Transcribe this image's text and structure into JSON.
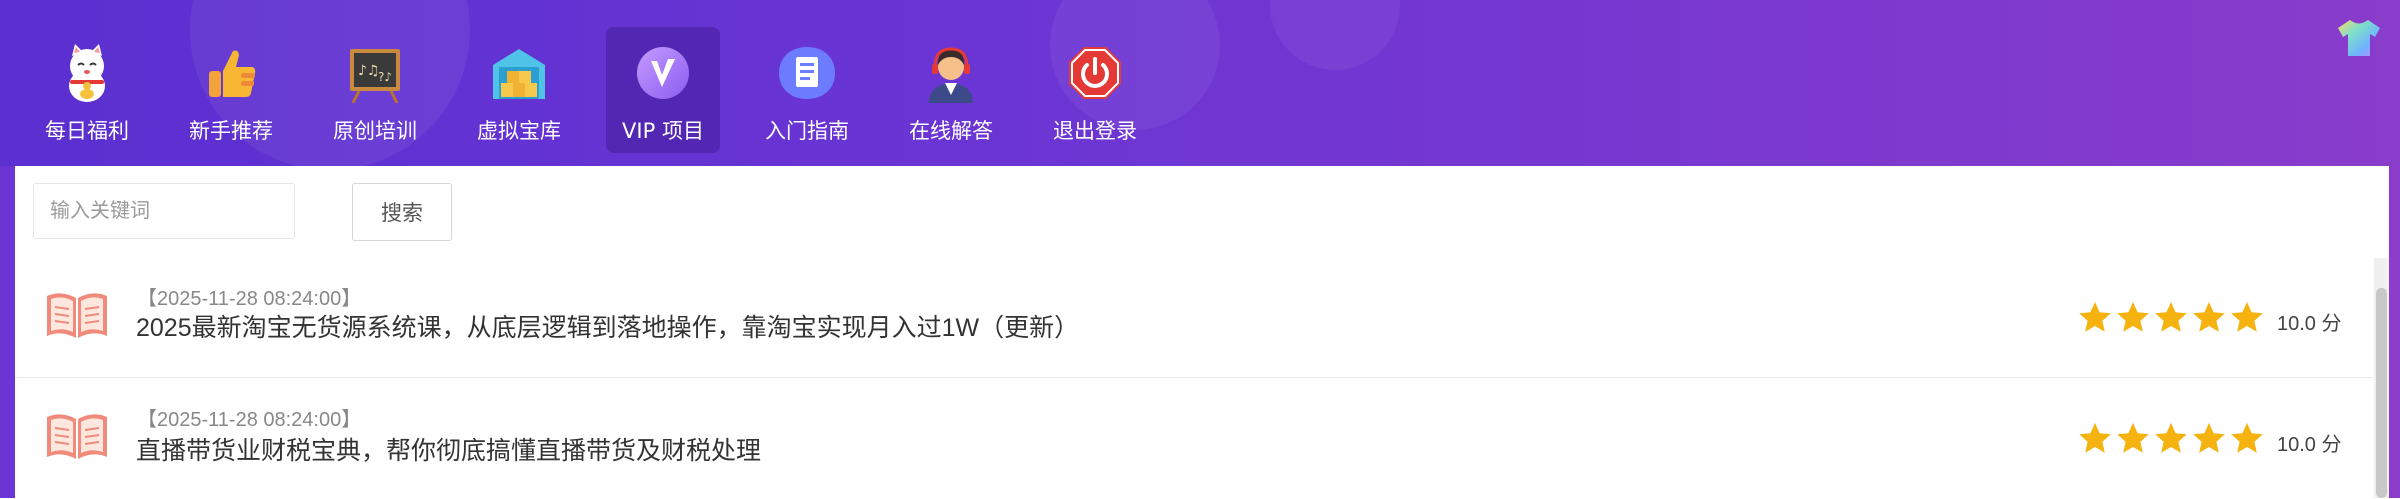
{
  "nav": {
    "items": [
      {
        "label": "每日福利",
        "icon": "lucky-cat-icon"
      },
      {
        "label": "新手推荐",
        "icon": "thumbs-up-icon"
      },
      {
        "label": "原创培训",
        "icon": "blackboard-icon"
      },
      {
        "label": "虚拟宝库",
        "icon": "warehouse-icon"
      },
      {
        "label": "VIP 项目",
        "icon": "vip-icon",
        "active": true
      },
      {
        "label": "入门指南",
        "icon": "document-icon"
      },
      {
        "label": "在线解答",
        "icon": "customer-service-icon"
      },
      {
        "label": "退出登录",
        "icon": "power-icon"
      }
    ]
  },
  "header": {
    "skin_icon": "tshirt-icon"
  },
  "search": {
    "placeholder": "输入关键词",
    "value": "",
    "button_label": "搜索"
  },
  "list": {
    "rows": [
      {
        "date": "【2025-11-28 08:24:00】",
        "title": "2025最新淘宝无货源系统课，从底层逻辑到落地操作，靠淘宝实现月入过1W（更新）",
        "stars": 5,
        "score": "10.0 分"
      },
      {
        "date": "【2025-11-28 08:24:00】",
        "title": "直播带货业财税宝典，帮你彻底搞懂直播带货及财税处理",
        "stars": 5,
        "score": "10.0 分"
      }
    ]
  },
  "colors": {
    "header_start": "#5b2fd0",
    "header_end": "#8a3ccb",
    "star": "#f6b20f",
    "book_icon": "#f08a7a"
  }
}
